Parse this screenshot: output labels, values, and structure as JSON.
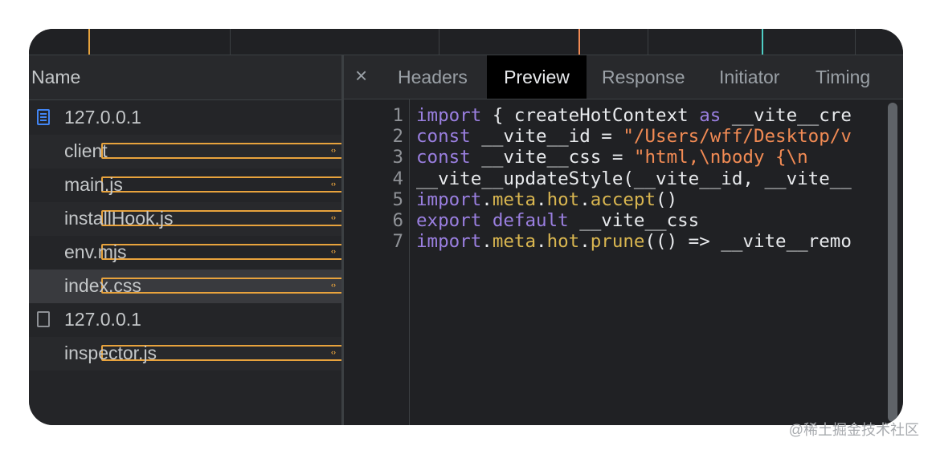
{
  "network": {
    "name_header": "Name",
    "rows": [
      {
        "name": "127.0.0.1",
        "icon": "document-icon"
      },
      {
        "name": "client",
        "icon": "code-file-icon"
      },
      {
        "name": "main.js",
        "icon": "code-file-icon"
      },
      {
        "name": "installHook.js",
        "icon": "code-file-icon"
      },
      {
        "name": "env.mjs",
        "icon": "code-file-icon"
      },
      {
        "name": "index.css",
        "icon": "code-file-icon"
      },
      {
        "name": "127.0.0.1",
        "icon": "blank-file-icon"
      },
      {
        "name": "inspector.js",
        "icon": "code-file-icon"
      }
    ],
    "selected_row": "index.css"
  },
  "tabs": {
    "close_symbol": "×",
    "headers": "Headers",
    "preview": "Preview",
    "response": "Response",
    "initiator": "Initiator",
    "timing": "Timing",
    "active": "Preview"
  },
  "code": {
    "line_numbers": [
      "1",
      "2",
      "3",
      "4",
      "5",
      "6",
      "7"
    ],
    "lines": [
      [
        {
          "t": "kw",
          "v": "import"
        },
        {
          "t": "id",
          "v": " { createHotContext "
        },
        {
          "t": "kw",
          "v": "as"
        },
        {
          "t": "id",
          "v": " __vite__cre"
        }
      ],
      [
        {
          "t": "kw",
          "v": "const"
        },
        {
          "t": "id",
          "v": " __vite__id = "
        },
        {
          "t": "str",
          "v": "\"/Users/wff/Desktop/v"
        }
      ],
      [
        {
          "t": "kw",
          "v": "const"
        },
        {
          "t": "id",
          "v": " __vite__css = "
        },
        {
          "t": "str",
          "v": "\"html,\\nbody {\\n"
        }
      ],
      [
        {
          "t": "id",
          "v": "__vite__updateStyle(__vite__id, __vite__"
        }
      ],
      [
        {
          "t": "kw",
          "v": "import"
        },
        {
          "t": "id",
          "v": "."
        },
        {
          "t": "prop",
          "v": "meta"
        },
        {
          "t": "id",
          "v": "."
        },
        {
          "t": "prop",
          "v": "hot"
        },
        {
          "t": "id",
          "v": "."
        },
        {
          "t": "prop",
          "v": "accept"
        },
        {
          "t": "id",
          "v": "()"
        }
      ],
      [
        {
          "t": "kw",
          "v": "export"
        },
        {
          "t": "id",
          "v": " "
        },
        {
          "t": "kw",
          "v": "default"
        },
        {
          "t": "id",
          "v": " __vite__css"
        }
      ],
      [
        {
          "t": "kw",
          "v": "import"
        },
        {
          "t": "id",
          "v": "."
        },
        {
          "t": "prop",
          "v": "meta"
        },
        {
          "t": "id",
          "v": "."
        },
        {
          "t": "prop",
          "v": "hot"
        },
        {
          "t": "id",
          "v": "."
        },
        {
          "t": "prop",
          "v": "prune"
        },
        {
          "t": "id",
          "v": "(() => __vite__remo"
        }
      ]
    ]
  },
  "colors": {
    "keyword": "#9a7fe0",
    "string": "#f28b54",
    "property": "#d9b650",
    "timeline_markers": [
      "#e8a33d",
      "#f28b54",
      "#4ecdc4"
    ]
  },
  "watermark": "@稀土掘金技术社区"
}
